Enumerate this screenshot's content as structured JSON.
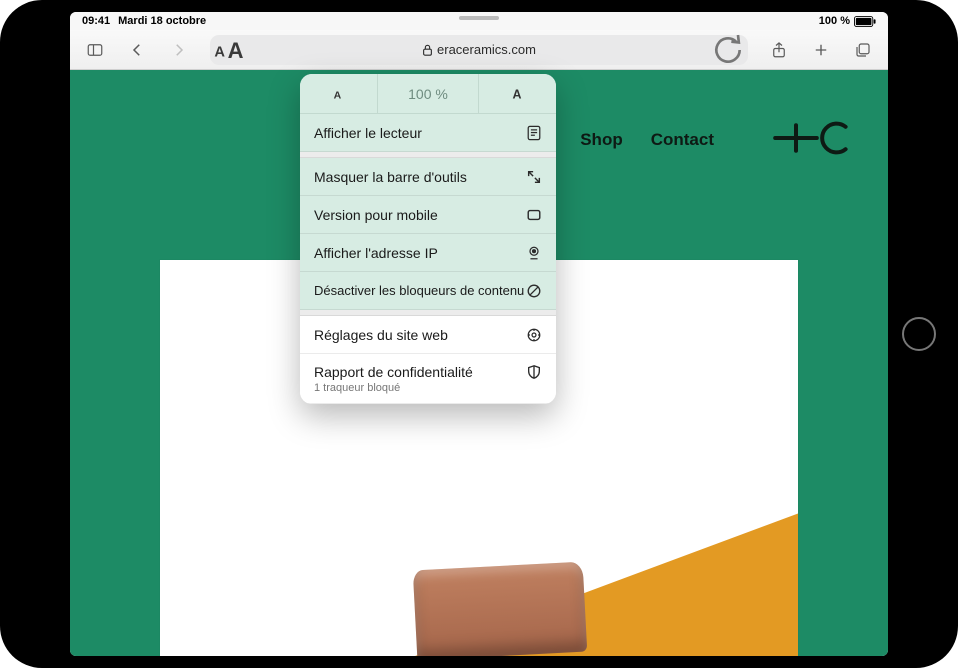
{
  "status": {
    "time": "09:41",
    "date": "Mardi 18 octobre",
    "battery_text": "100 %"
  },
  "toolbar": {
    "url": "eraceramics.com"
  },
  "site": {
    "nav": [
      {
        "label": "Shop"
      },
      {
        "label": "Contact"
      }
    ]
  },
  "popover": {
    "zoom_value": "100 %",
    "items": [
      {
        "label": "Afficher le lecteur",
        "icon": "reader",
        "tint": "green"
      },
      {
        "label": "Masquer la barre d'outils",
        "icon": "expand",
        "tint": "green"
      },
      {
        "label": "Version pour mobile",
        "icon": "rect",
        "tint": "green"
      },
      {
        "label": "Afficher l'adresse IP",
        "icon": "pin",
        "tint": "green"
      },
      {
        "label": "Désactiver les bloqueurs de contenu",
        "icon": "noblock",
        "tint": "green"
      }
    ],
    "settings": {
      "label": "Réglages du site web",
      "icon": "gear"
    },
    "privacy": {
      "label": "Rapport de confidentialité",
      "subtitle": "1 traqueur bloqué",
      "icon": "shield"
    }
  }
}
